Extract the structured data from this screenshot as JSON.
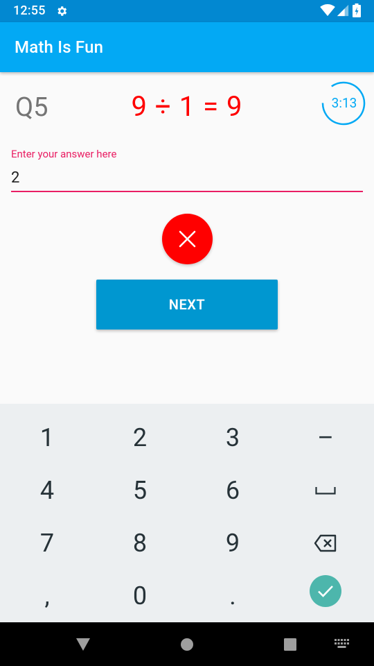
{
  "status_bar": {
    "time": "12:55"
  },
  "app_bar": {
    "title": "Math Is Fun"
  },
  "question": {
    "label": "Q5",
    "equation": "9 ÷ 1 = 9",
    "timer": "3:13"
  },
  "answer_field": {
    "label": "Enter your answer here",
    "value": "2"
  },
  "result": {
    "status": "wrong",
    "color": "#ff0000"
  },
  "next_button": {
    "label": "NEXT"
  },
  "keyboard": {
    "rows": [
      [
        "1",
        "2",
        "3",
        "–"
      ],
      [
        "4",
        "5",
        "6",
        "space"
      ],
      [
        "7",
        "8",
        "9",
        "backspace"
      ],
      [
        ",",
        "0",
        ".",
        "done"
      ]
    ],
    "labels": {
      "k1": "1",
      "k2": "2",
      "k3": "3",
      "kminus": "–",
      "k4": "4",
      "k5": "5",
      "k6": "6",
      "k7": "7",
      "k8": "8",
      "k9": "9",
      "kcomma": ",",
      "k0": "0",
      "kperiod": "."
    }
  },
  "colors": {
    "primary": "#03a9f4",
    "primary_dark": "#0288d1",
    "accent": "#e91e63",
    "error": "#ff0000",
    "button": "#0097d0",
    "done_key": "#4db6ac"
  }
}
